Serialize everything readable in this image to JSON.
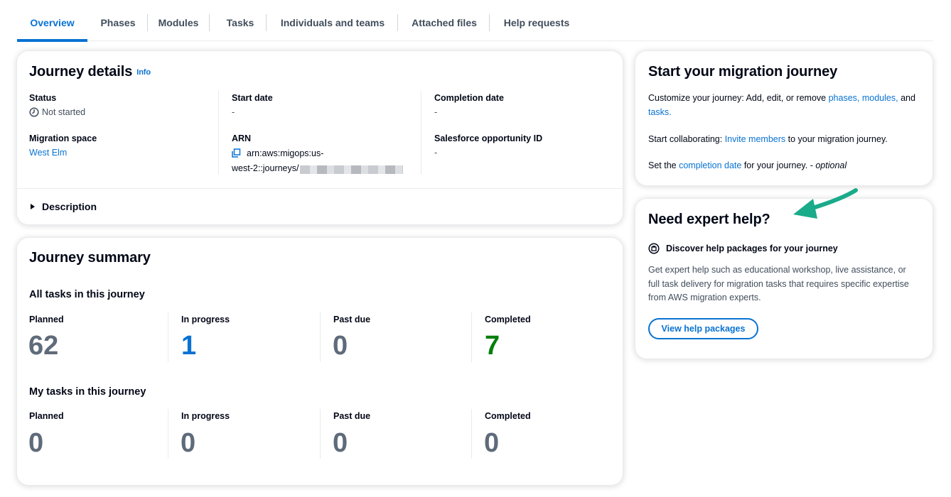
{
  "tabs": [
    {
      "label": "Overview",
      "active": true
    },
    {
      "label": "Phases"
    },
    {
      "label": "Modules"
    },
    {
      "label": "Tasks"
    },
    {
      "label": "Individuals and teams"
    },
    {
      "label": "Attached files"
    },
    {
      "label": "Help requests"
    }
  ],
  "journey_details": {
    "title": "Journey details",
    "info_label": "Info",
    "status_label": "Status",
    "status_value": "Not started",
    "start_date_label": "Start date",
    "start_date_value": "-",
    "completion_date_label": "Completion date",
    "completion_date_value": "-",
    "migration_space_label": "Migration space",
    "migration_space_value": "West Elm",
    "arn_label": "ARN",
    "arn_line1": "arn:aws:migops:us-",
    "arn_line2": "west-2::journeys/",
    "salesforce_label": "Salesforce opportunity ID",
    "salesforce_value": "-",
    "description_label": "Description"
  },
  "journey_summary": {
    "title": "Journey summary",
    "all_tasks_title": "All tasks in this journey",
    "my_tasks_title": "My tasks in this journey",
    "labels": {
      "planned": "Planned",
      "in_progress": "In progress",
      "past_due": "Past due",
      "completed": "Completed"
    },
    "all_tasks": {
      "planned": "62",
      "in_progress": "1",
      "past_due": "0",
      "completed": "7"
    },
    "my_tasks": {
      "planned": "0",
      "in_progress": "0",
      "past_due": "0",
      "completed": "0"
    }
  },
  "start_journey": {
    "title": "Start your migration journey",
    "p1_prefix": "Customize your journey: Add, edit, or remove ",
    "p1_link_phases": "phases,",
    "p1_link_modules": "modules,",
    "p1_and": " and",
    "p1_link_tasks": "tasks.",
    "p2_prefix": "Start collaborating: ",
    "p2_link": "Invite members",
    "p2_suffix": " to your migration journey.",
    "p3_prefix": "Set the ",
    "p3_link": "completion date",
    "p3_suffix": " for your journey. - ",
    "p3_optional": "optional"
  },
  "expert_help": {
    "title": "Need expert help?",
    "subtitle": "Discover help packages for your journey",
    "description_line1": "Get expert help such as educational workshop, live assistance, or",
    "description_line2": "full task delivery for migration tasks that requires specific expertise",
    "description_line3": "from AWS migration experts.",
    "button_label": "View help packages"
  },
  "colors": {
    "accent": "#0972d3",
    "in_progress": "#0972d3",
    "completed": "#037f0c",
    "muted_number": "#5f6b7a",
    "annotation_arrow": "#1aab8a"
  }
}
